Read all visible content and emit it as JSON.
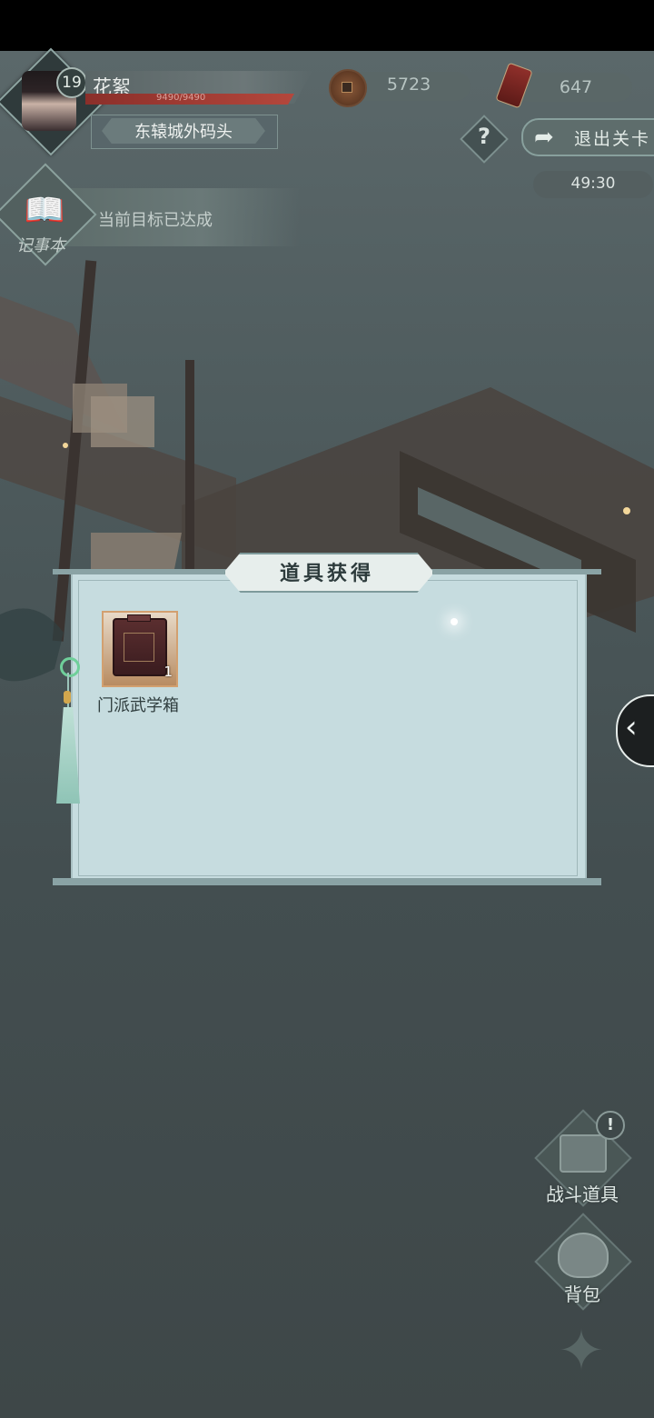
{
  "player": {
    "level": "19",
    "name": "花絮",
    "hp": "9490/9490",
    "location": "东辕城外码头"
  },
  "currency": {
    "coins": "5723",
    "tokens": "647"
  },
  "controls": {
    "help": "?",
    "exit_label": "退出关卡",
    "timer": "49:30"
  },
  "journal": {
    "label": "记事本",
    "status": "当前目标已达成"
  },
  "dialog": {
    "title": "道具获得",
    "items": [
      {
        "name": "门派武学箱",
        "count": "1"
      }
    ]
  },
  "right_menu": {
    "battle_items": "战斗道具",
    "notice": "!",
    "bag": "背包"
  },
  "icons": {
    "side_panel": "chevron-left-icon",
    "coin": "copper-coin-icon",
    "token": "token-icon",
    "help": "question-icon",
    "exit": "exit-arrow-icon",
    "journal": "book-icon",
    "item": "chest-icon",
    "battle_items": "treasure-chest-icon",
    "bag": "pouch-icon",
    "skill": "star-icon"
  }
}
